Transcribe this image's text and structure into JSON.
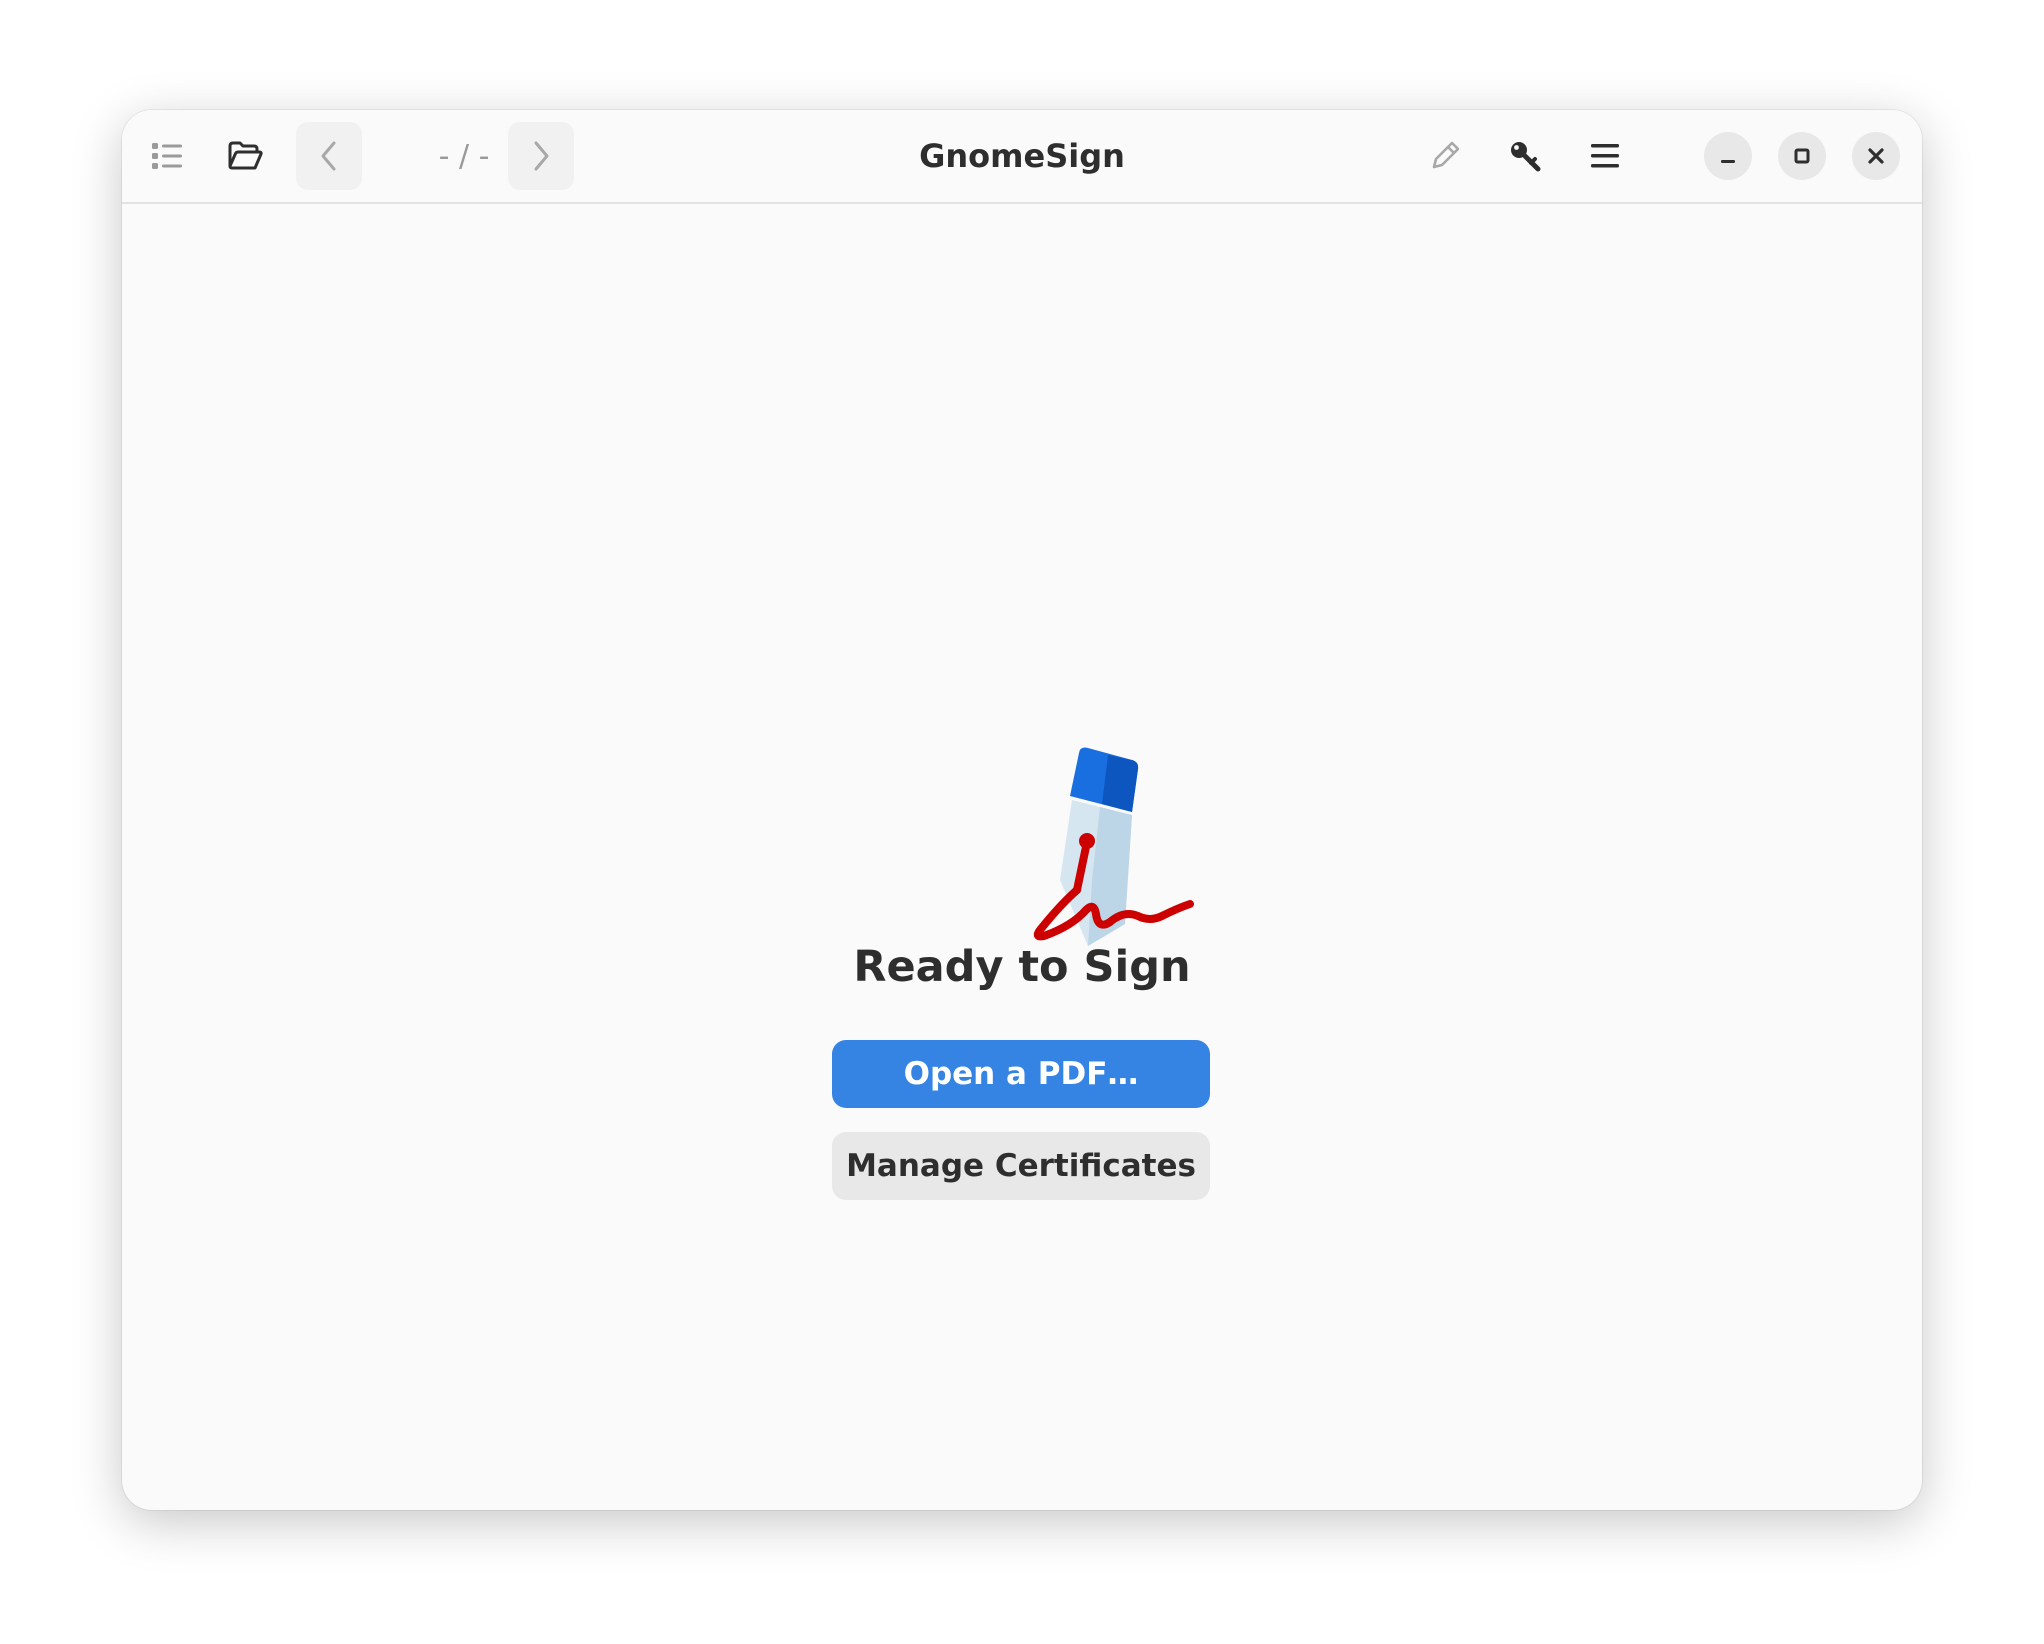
{
  "app": {
    "title": "GnomeSign"
  },
  "headerbar": {
    "page_indicator": "- / -",
    "icons": {
      "sidebar": "sidebar-list-icon",
      "open": "folder-open-icon",
      "prev": "chevron-left-icon",
      "next": "chevron-right-icon",
      "sign": "pencil-icon",
      "certificates": "key-icon",
      "menu": "hamburger-menu-icon",
      "minimize": "minimize-icon",
      "maximize": "maximize-icon",
      "close": "close-icon"
    }
  },
  "main": {
    "heading": "Ready to Sign",
    "open_pdf_label": "Open a PDF…",
    "manage_certificates_label": "Manage Certificates",
    "hero_icon": "pen-signature-icon"
  },
  "colors": {
    "accent": "#3584e4",
    "signature_red": "#cc0000",
    "pen_blue": "#1a6fe0",
    "window_bg": "#fafafa"
  }
}
